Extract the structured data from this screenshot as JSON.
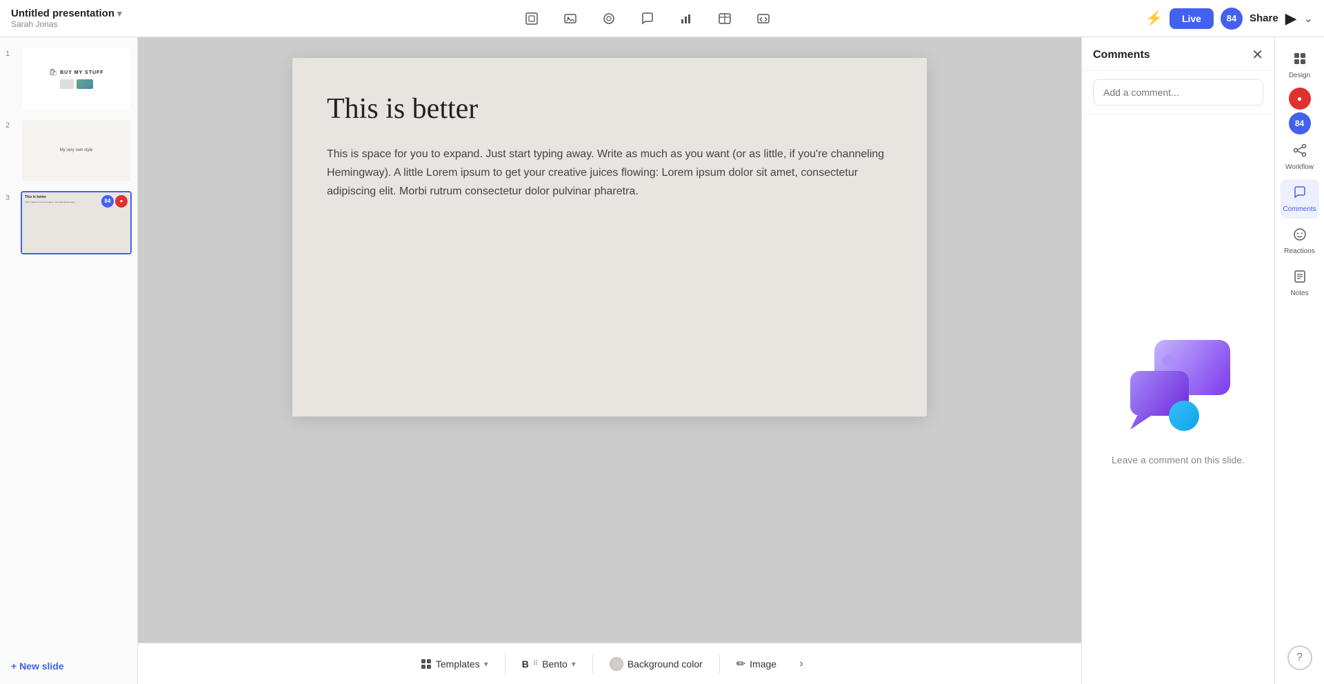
{
  "topbar": {
    "title": "Untitled presentation",
    "subtitle": "Sarah Jonas",
    "chevron": "▾",
    "live_label": "Live",
    "share_label": "Share",
    "play_label": "▶",
    "chevron_right": "⌄",
    "avatar_label": "84"
  },
  "toolbar_icons": [
    {
      "name": "frame-icon",
      "symbol": "⊞"
    },
    {
      "name": "image-icon",
      "symbol": "🖼"
    },
    {
      "name": "chart-icon",
      "symbol": "◎"
    },
    {
      "name": "comment-icon",
      "symbol": "💬"
    },
    {
      "name": "bar-chart-icon",
      "symbol": "📊"
    },
    {
      "name": "table-icon",
      "symbol": "⊟"
    },
    {
      "name": "embed-icon",
      "symbol": "⊡"
    }
  ],
  "slides": [
    {
      "number": "1",
      "type": "buy-stuff",
      "title": "BUY MY STUFF",
      "active": false,
      "badges": []
    },
    {
      "number": "2",
      "type": "my-style",
      "text": "My very own style",
      "active": false,
      "badges": []
    },
    {
      "number": "3",
      "type": "this-is-better",
      "title": "This is better",
      "body": "This is space for you to expand...",
      "active": true,
      "badges": [
        {
          "color": "blue",
          "label": "84"
        },
        {
          "color": "red",
          "label": ""
        }
      ]
    }
  ],
  "new_slide_label": "+ New slide",
  "canvas": {
    "title": "This is better",
    "body": "This is space for you to expand. Just start typing away. Write as much as you want (or as little, if you're channeling Hemingway). A little Lorem ipsum to get your creative juices flowing: Lorem ipsum dolor sit amet, consectetur adipiscing elit. Morbi rutrum consectetur dolor pulvinar pharetra."
  },
  "bottom_bar": {
    "templates_label": "Templates",
    "bento_label": "Bento",
    "bg_color_label": "Background color",
    "image_label": "Image",
    "chevron_label": "›"
  },
  "comments_panel": {
    "title": "Comments",
    "close_icon": "✕",
    "input_placeholder": "Add a comment...",
    "empty_text": "Leave a comment on this slide."
  },
  "right_sidebar": {
    "design_label": "Design",
    "workflow_label": "Workflow",
    "comments_label": "Comments",
    "reactions_label": "Reactions",
    "notes_label": "Notes",
    "avatar1_label": "84",
    "avatar2_label": "84",
    "help_label": "?"
  }
}
